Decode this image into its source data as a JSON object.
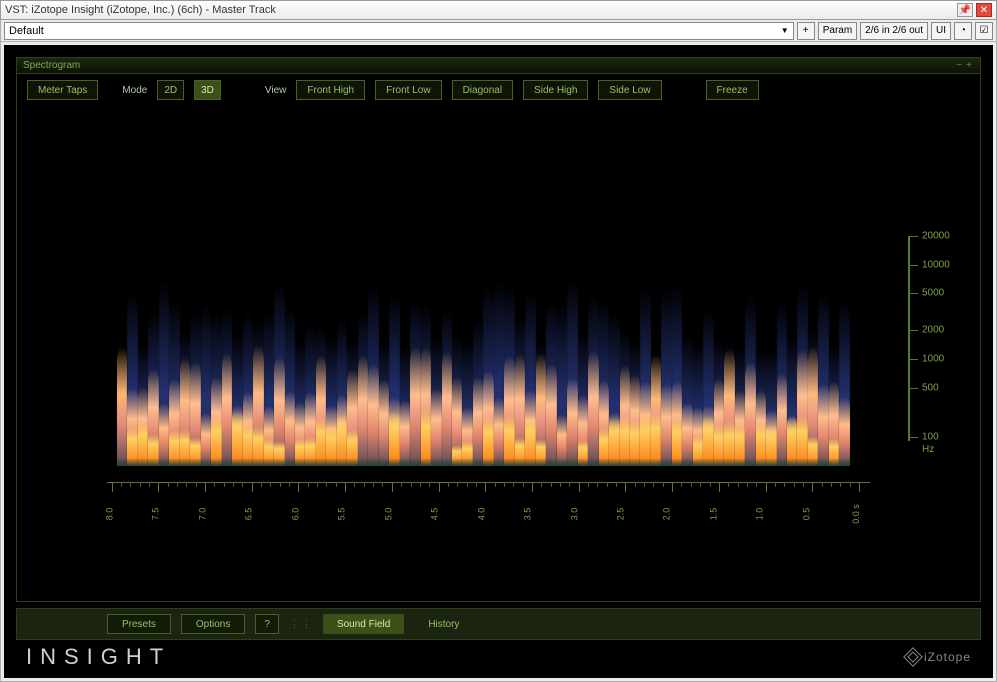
{
  "window": {
    "title": "VST: iZotope Insight (iZotope, Inc.) (6ch) - Master Track"
  },
  "host_toolbar": {
    "preset": "Default",
    "add_btn": "+",
    "param_btn": "Param",
    "io_btn": "2/6 in 2/6 out",
    "ui_btn": "UI"
  },
  "panel": {
    "title": "Spectrogram",
    "collapse_minus": "−",
    "collapse_plus": "+",
    "meter_taps_btn": "Meter Taps",
    "mode_label": "Mode",
    "mode_btns": {
      "m2d": "2D",
      "m3d": "3D"
    },
    "view_label": "View",
    "view_btns": {
      "front_high": "Front High",
      "front_low": "Front Low",
      "diagonal": "Diagonal",
      "side_high": "Side High",
      "side_low": "Side Low"
    },
    "freeze_btn": "Freeze"
  },
  "axes": {
    "freq_unit": "Hz",
    "freq_ticks": [
      "20000",
      "10000",
      "5000",
      "2000",
      "1000",
      "500",
      "100"
    ],
    "time_labels": [
      "8.0",
      "7.5",
      "7.0",
      "6.5",
      "6.0",
      "5.5",
      "5.0",
      "4.5",
      "4.0",
      "3.5",
      "3.0",
      "2.5",
      "2.0",
      "1.5",
      "1.0",
      "0.5",
      "0.0 s"
    ]
  },
  "bottom": {
    "presets_btn": "Presets",
    "options_btn": "Options",
    "help_btn": "?",
    "tabs": {
      "sound_field": "Sound Field",
      "history": "History"
    }
  },
  "footer": {
    "product": "INSIGHT",
    "vendor": "iZotope"
  }
}
